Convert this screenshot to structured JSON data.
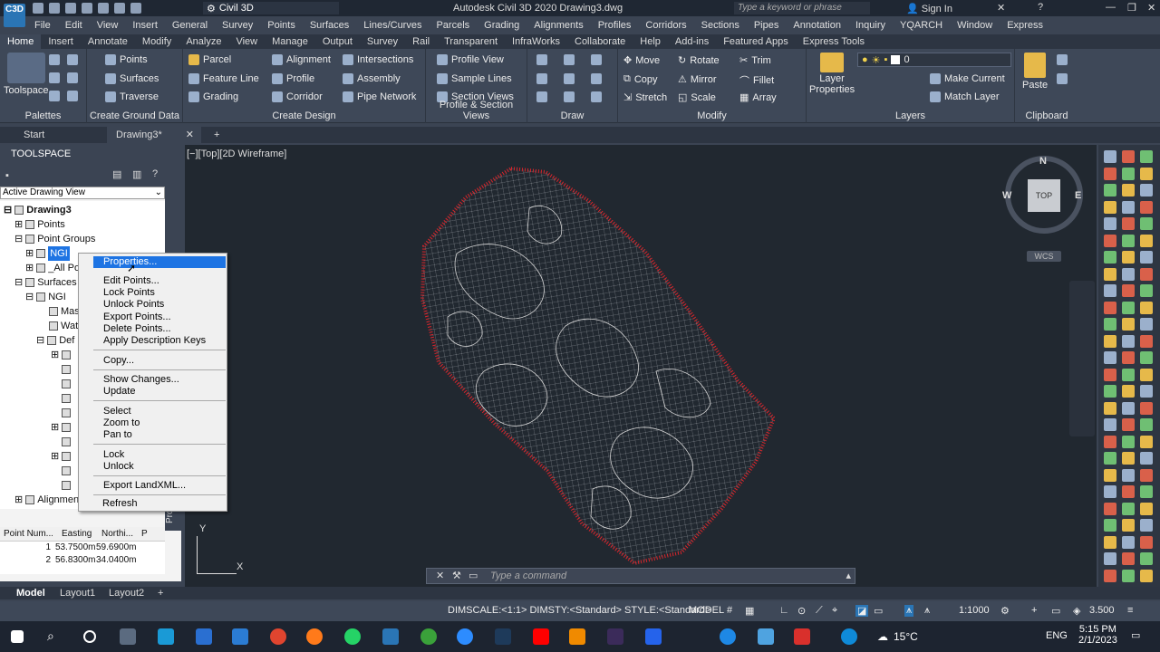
{
  "title_bar": {
    "workspace": "Civil 3D",
    "app_title": "Autodesk Civil 3D 2020    Drawing3.dwg",
    "search_placeholder": "Type a keyword or phrase",
    "sign_in": "Sign In"
  },
  "logo": {
    "text": "C3D"
  },
  "menubar": [
    "File",
    "Edit",
    "View",
    "Insert",
    "General",
    "Survey",
    "Points",
    "Surfaces",
    "Lines/Curves",
    "Parcels",
    "Grading",
    "Alignments",
    "Profiles",
    "Corridors",
    "Sections",
    "Pipes",
    "Annotation",
    "Inquiry",
    "YQARCH",
    "Window",
    "Express"
  ],
  "ribbon_tabs": [
    "Home",
    "Insert",
    "Annotate",
    "Modify",
    "Analyze",
    "View",
    "Manage",
    "Output",
    "Survey",
    "Rail",
    "Transparent",
    "InfraWorks",
    "Collaborate",
    "Help",
    "Add-ins",
    "Featured Apps",
    "Express Tools"
  ],
  "ribbon": {
    "toolspace": "Toolspace",
    "palettes": "Palettes",
    "ground": {
      "points": "Points",
      "surfaces": "Surfaces",
      "traverse": "Traverse",
      "title": "Create Ground Data"
    },
    "design": {
      "parcel": "Parcel",
      "feature_line": "Feature Line",
      "grading": "Grading",
      "alignment": "Alignment",
      "profile": "Profile",
      "corridor": "Corridor",
      "intersections": "Intersections",
      "assembly": "Assembly",
      "pipe_network": "Pipe Network",
      "title": "Create Design"
    },
    "profile_section": {
      "profile_view": "Profile View",
      "sample_lines": "Sample Lines",
      "section_views": "Section Views",
      "title": "Profile & Section Views"
    },
    "draw": {
      "title": "Draw"
    },
    "modify": {
      "move": "Move",
      "rotate": "Rotate",
      "trim": "Trim",
      "copy": "Copy",
      "mirror": "Mirror",
      "fillet": "Fillet",
      "stretch": "Stretch",
      "scale": "Scale",
      "array": "Array",
      "title": "Modify"
    },
    "layers": {
      "layer_properties": "Layer Properties",
      "layer_name": "0",
      "make_current": "Make Current",
      "match_layer": "Match Layer",
      "title": "Layers"
    },
    "clipboard": {
      "paste": "Paste",
      "title": "Clipboard"
    }
  },
  "doc_tabs": {
    "start": "Start",
    "drawing": "Drawing3*"
  },
  "toolspace": {
    "header": "TOOLSPACE",
    "view_dropdown": "Active Drawing View",
    "side_tab": "Prospector",
    "tree": {
      "drawing": "Drawing3",
      "points": "Points",
      "point_groups": "Point Groups",
      "ngi": "NGI",
      "all_points": "_All Po",
      "surfaces": "Surfaces",
      "ngi_surface": "NGI",
      "masks": "Mas",
      "watersheds": "Wat",
      "definition": "Def",
      "alignments": "Alignmen"
    },
    "grid_headers": [
      "Point Num...",
      "Easting",
      "Northi...",
      "P"
    ],
    "grid_rows": [
      [
        "1",
        "53.7500m",
        "59.6900m"
      ],
      [
        "2",
        "56.8300m",
        "34.0400m"
      ]
    ]
  },
  "context_menu": {
    "properties": "Properties...",
    "edit_points": "Edit Points...",
    "lock_points": "Lock Points",
    "unlock_points": "Unlock Points",
    "export_points": "Export Points...",
    "delete_points": "Delete Points...",
    "apply_desc_keys": "Apply Description Keys",
    "copy": "Copy...",
    "show_changes": "Show Changes...",
    "update": "Update",
    "select": "Select",
    "zoom_to": "Zoom to",
    "pan_to": "Pan to",
    "lock": "Lock",
    "unlock": "Unlock",
    "export_landxml": "Export LandXML...",
    "refresh": "Refresh"
  },
  "canvas": {
    "view_label": "[−][Top][2D Wireframe]",
    "compass": {
      "n": "N",
      "s": "S",
      "e": "E",
      "w": "W",
      "top": "TOP",
      "wcs": "WCS"
    },
    "ucs_x": "X",
    "ucs_y": "Y"
  },
  "command": {
    "placeholder": "Type a command"
  },
  "layouts": {
    "model": "Model",
    "layout1": "Layout1",
    "layout2": "Layout2"
  },
  "status": {
    "dimscale": "DIMSCALE:<1:1> DIMSTY:<Standard> STYLE:<Standard>",
    "model": "MODEL",
    "scale": "1:1000",
    "value": "3.500"
  },
  "taskbar": {
    "temperature": "15°C",
    "lang": "ENG",
    "time": "5:15 PM",
    "date": "2/1/2023"
  },
  "colors": {
    "selection": "#1e74e3",
    "boundary": "#d9252b",
    "contour": "#cfcfcf"
  }
}
